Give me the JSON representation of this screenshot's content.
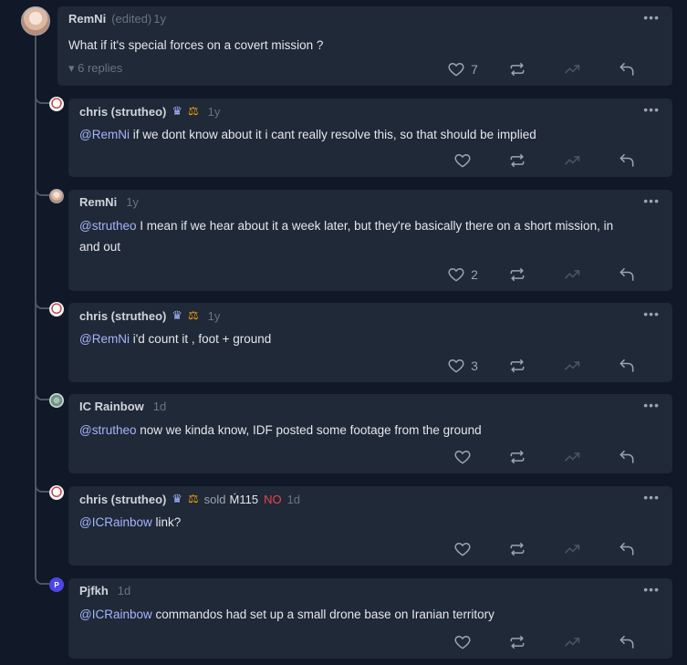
{
  "root": {
    "author": "RemNi",
    "edited": "(edited)",
    "time": "1y",
    "text": "What if it's special forces on a covert mission ?",
    "replies_label": "▾ 6 replies",
    "likes": "7"
  },
  "replies": [
    {
      "author": "chris (strutheo)",
      "time": "1y",
      "mention": "@RemNi",
      "text": " if we dont know about it i cant really resolve this, so that should be implied",
      "likes": ""
    },
    {
      "author": "RemNi",
      "time": "1y",
      "mention": "@strutheo",
      "text": " I mean if we hear about it a week later, but they're basically there on a short mission, in and out",
      "likes": "2"
    },
    {
      "author": "chris (strutheo)",
      "time": "1y",
      "mention": "@RemNi",
      "text": " i'd count it , foot + ground",
      "likes": "3"
    },
    {
      "author": "IC Rainbow",
      "time": "1d",
      "mention": "@strutheo",
      "text": " now we kinda know, IDF posted some footage from the ground",
      "likes": ""
    },
    {
      "author": "chris (strutheo)",
      "time": "1d",
      "sold": "sold",
      "amount": "Ḿ115",
      "outcome": "NO",
      "mention": "@ICRainbow",
      "text": " link?",
      "likes": ""
    },
    {
      "author": "Pjfkh",
      "time": "1d",
      "mention": "@ICRainbow",
      "text": " commandos had set up a small drone base on Iranian territory",
      "likes": ""
    }
  ],
  "avatar_initial": "P",
  "menu_glyph": "•••",
  "crown_glyph": "♛",
  "scale_glyph": "⚖"
}
